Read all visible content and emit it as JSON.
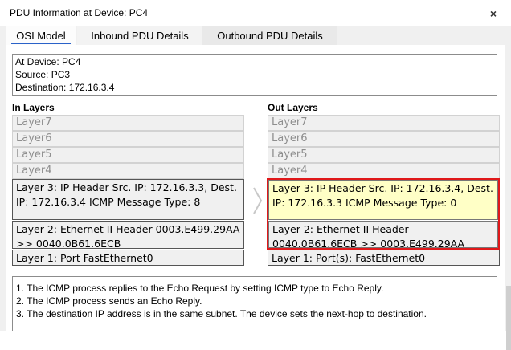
{
  "window": {
    "title": "PDU Information at Device: PC4",
    "close_label": "×"
  },
  "tabs": [
    {
      "label": "OSI Model"
    },
    {
      "label": "Inbound PDU Details"
    },
    {
      "label": "Outbound PDU Details"
    }
  ],
  "info": {
    "device": "At Device: PC4",
    "source": "Source: PC3",
    "destination": "Destination: 172.16.3.4"
  },
  "in_layers": {
    "heading": "In Layers",
    "layers": [
      "Layer7",
      "Layer6",
      "Layer5",
      "Layer4",
      "Layer 3: IP Header Src. IP: 172.16.3.3, Dest. IP: 172.16.3.4 ICMP Message Type: 8",
      "Layer 2: Ethernet II Header 0003.E499.29AA >> 0040.0B61.6ECB",
      "Layer 1: Port FastEthernet0"
    ]
  },
  "out_layers": {
    "heading": "Out Layers",
    "layers": [
      "Layer7",
      "Layer6",
      "Layer5",
      "Layer4",
      "Layer 3: IP Header Src. IP: 172.16.3.4, Dest. IP: 172.16.3.3 ICMP Message Type: 0",
      "Layer 2: Ethernet II Header 0040.0B61.6ECB >> 0003.E499.29AA",
      "Layer 1: Port(s): FastEthernet0"
    ]
  },
  "notes": [
    "1. The ICMP process replies to the Echo Request by setting ICMP type to Echo Reply.",
    "2. The ICMP process sends an Echo Reply.",
    "3. The destination IP address is in the same subnet. The device sets the next-hop to destination."
  ],
  "colors": {
    "highlight_border": "#e0181a",
    "highlight_fill": "#ffffc6",
    "tab_underline": "#2a62c9"
  }
}
